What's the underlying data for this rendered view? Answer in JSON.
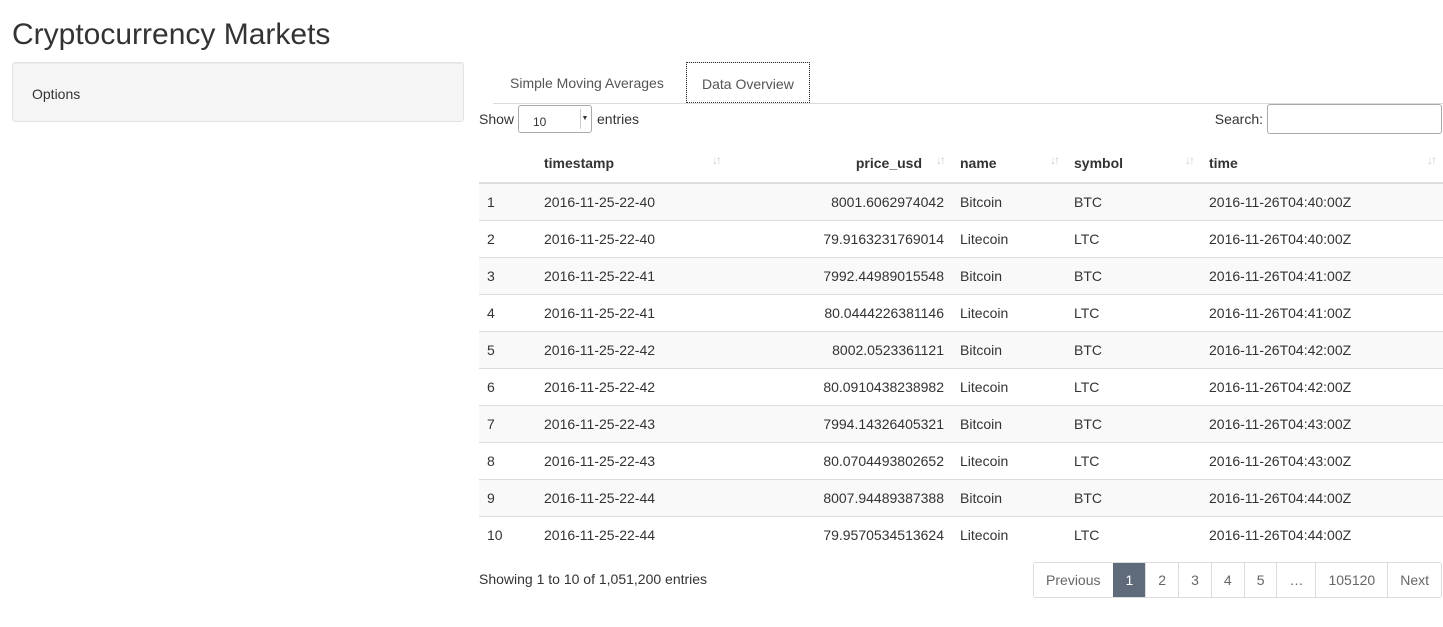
{
  "app": {
    "title": "Cryptocurrency Markets"
  },
  "sidebar": {
    "options_label": "Options"
  },
  "tabs": [
    {
      "label": "Simple Moving Averages",
      "active": false
    },
    {
      "label": "Data Overview",
      "active": true
    }
  ],
  "controls": {
    "show_label": "Show",
    "length_value": "10",
    "entries_label": "entries",
    "search_label": "Search:",
    "search_value": ""
  },
  "table": {
    "columns": [
      "",
      "timestamp",
      "price_usd",
      "name",
      "symbol",
      "time"
    ],
    "rows": [
      [
        "1",
        "2016-11-25-22-40",
        "8001.6062974042",
        "Bitcoin",
        "BTC",
        "2016-11-26T04:40:00Z"
      ],
      [
        "2",
        "2016-11-25-22-40",
        "79.9163231769014",
        "Litecoin",
        "LTC",
        "2016-11-26T04:40:00Z"
      ],
      [
        "3",
        "2016-11-25-22-41",
        "7992.44989015548",
        "Bitcoin",
        "BTC",
        "2016-11-26T04:41:00Z"
      ],
      [
        "4",
        "2016-11-25-22-41",
        "80.0444226381146",
        "Litecoin",
        "LTC",
        "2016-11-26T04:41:00Z"
      ],
      [
        "5",
        "2016-11-25-22-42",
        "8002.0523361121",
        "Bitcoin",
        "BTC",
        "2016-11-26T04:42:00Z"
      ],
      [
        "6",
        "2016-11-25-22-42",
        "80.0910438238982",
        "Litecoin",
        "LTC",
        "2016-11-26T04:42:00Z"
      ],
      [
        "7",
        "2016-11-25-22-43",
        "7994.14326405321",
        "Bitcoin",
        "BTC",
        "2016-11-26T04:43:00Z"
      ],
      [
        "8",
        "2016-11-25-22-43",
        "80.0704493802652",
        "Litecoin",
        "LTC",
        "2016-11-26T04:43:00Z"
      ],
      [
        "9",
        "2016-11-25-22-44",
        "8007.94489387388",
        "Bitcoin",
        "BTC",
        "2016-11-26T04:44:00Z"
      ],
      [
        "10",
        "2016-11-25-22-44",
        "79.9570534513624",
        "Litecoin",
        "LTC",
        "2016-11-26T04:44:00Z"
      ]
    ]
  },
  "footer": {
    "info": "Showing 1 to 10 of 1,051,200 entries",
    "pages": [
      {
        "label": "Previous",
        "kind": "prev"
      },
      {
        "label": "1",
        "kind": "active"
      },
      {
        "label": "2",
        "kind": "page"
      },
      {
        "label": "3",
        "kind": "page"
      },
      {
        "label": "4",
        "kind": "page"
      },
      {
        "label": "5",
        "kind": "page"
      },
      {
        "label": "…",
        "kind": "ellipsis"
      },
      {
        "label": "105120",
        "kind": "page"
      },
      {
        "label": "Next",
        "kind": "next"
      }
    ]
  },
  "colors": {
    "active_page": "#5f6b7a",
    "stripe": "#f9f9f9",
    "border": "#dddddd"
  },
  "icons": {
    "sort": "sort-both-icon",
    "select": "chevron-down-icon"
  }
}
